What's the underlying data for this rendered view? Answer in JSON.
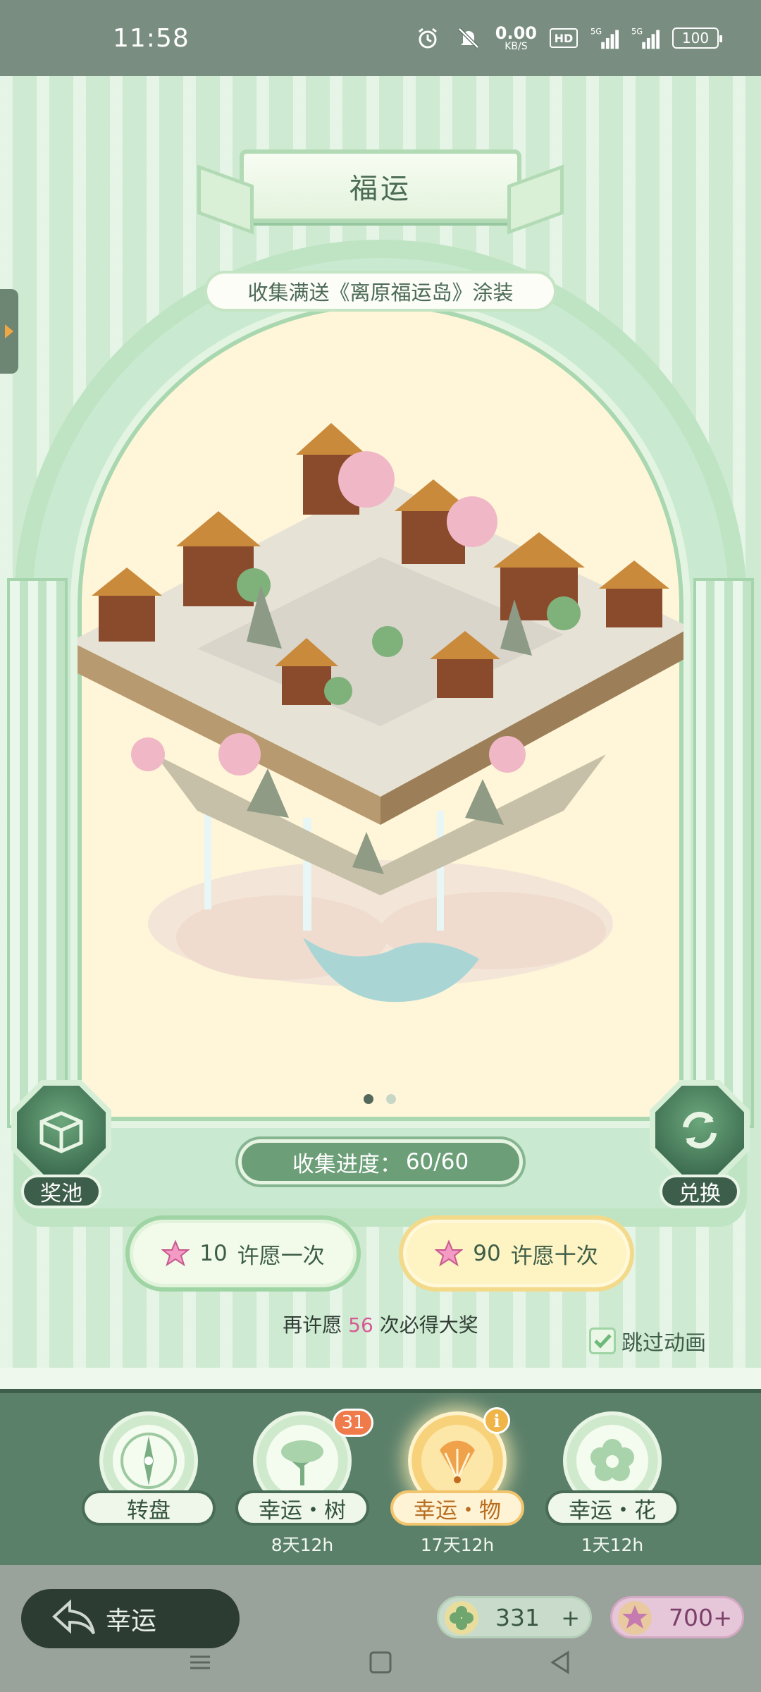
{
  "status_bar": {
    "time": "11:58",
    "net_speed_value": "0.00",
    "net_speed_unit": "KB/S",
    "hd_label": "HD",
    "signal1_label": "5G",
    "signal2_label": "5G",
    "battery": "100",
    "icons": [
      "alarm-icon",
      "mute-icon",
      "hd-icon",
      "signal-icon",
      "signal-icon",
      "battery-icon"
    ]
  },
  "header": {
    "title": "福运",
    "subtitle": "收集满送《离原福运岛》涂装"
  },
  "carousel": {
    "page_count": 2,
    "active_index": 0
  },
  "side_buttons": {
    "pool_label": "奖池",
    "exchange_label": "兑换"
  },
  "progress": {
    "label": "收集进度：",
    "value": "60/60"
  },
  "wish": {
    "one": {
      "cost": "10",
      "label": "许愿一次"
    },
    "ten": {
      "cost": "90",
      "label": "许愿十次"
    }
  },
  "hint": {
    "prefix": "再许愿",
    "count": "56",
    "suffix": "次必得大奖"
  },
  "skip_animation": {
    "label": "跳过动画",
    "checked": true
  },
  "tabs": [
    {
      "label": "转盘",
      "time": "",
      "icon": "compass-icon"
    },
    {
      "label": "幸运・树",
      "time": "8天12h",
      "icon": "tree-icon",
      "badge": "31"
    },
    {
      "label": "幸运・物",
      "time": "17天12h",
      "icon": "fan-icon",
      "active": true
    },
    {
      "label": "幸运・花",
      "time": "1天12h",
      "icon": "flower-icon"
    }
  ],
  "footer": {
    "back_label": "幸运",
    "clover_amount": "331",
    "star_amount": "700"
  },
  "colors": {
    "accent_green": "#5b806a",
    "hint_number_pink": "#d65a94",
    "active_tab_gold": "#f2c46c"
  }
}
